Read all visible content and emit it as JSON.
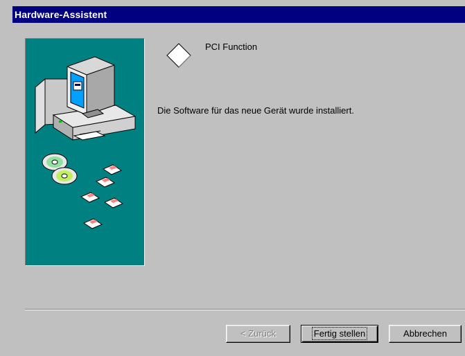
{
  "window": {
    "title": "Hardware-Assistent"
  },
  "device": {
    "icon": "diamond-device-icon",
    "name": "PCI Function"
  },
  "main": {
    "message": "Die Software für das neue Gerät wurde installiert."
  },
  "buttons": {
    "back_label": "< Zurück",
    "finish_label": "Fertig stellen",
    "cancel_label": "Abbrechen",
    "back_enabled": false
  },
  "colors": {
    "title_bar": "#000080",
    "dialog_face": "#c0c0c0",
    "illustration_bg": "#008080"
  }
}
